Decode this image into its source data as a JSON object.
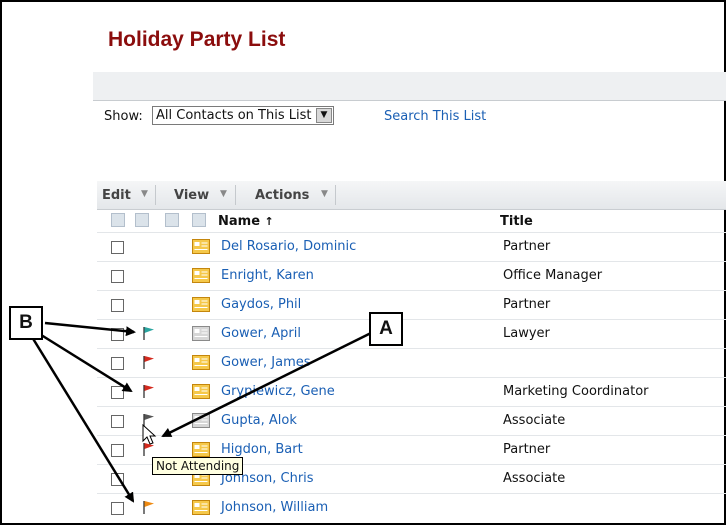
{
  "page": {
    "title": "Holiday Party List"
  },
  "filter": {
    "show_label": "Show:",
    "selected": "All Contacts on This List",
    "search_link": "Search This List"
  },
  "toolbar": {
    "edit": "Edit",
    "view": "View",
    "actions": "Actions"
  },
  "columns": {
    "name": "Name",
    "sort_indicator": "↑",
    "title": "Title"
  },
  "rows": [
    {
      "name": "Del Rosario, Dominic",
      "title": "Partner",
      "flag": "none",
      "card": "card-icon"
    },
    {
      "name": "Enright, Karen",
      "title": "Office Manager",
      "flag": "none",
      "card": "card-icon"
    },
    {
      "name": "Gaydos, Phil",
      "title": "Partner",
      "flag": "none",
      "card": "card-icon"
    },
    {
      "name": "Gower, April",
      "title": "Lawyer",
      "flag": "teal",
      "card": "card-gray-icon"
    },
    {
      "name": "Gower, James",
      "title": "",
      "flag": "red",
      "card": "card-icon"
    },
    {
      "name": "Grypiewicz, Gene",
      "title": "Marketing Coordinator",
      "flag": "red",
      "card": "card-icon"
    },
    {
      "name": "Gupta, Alok",
      "title": "Associate",
      "flag": "gray",
      "card": "card-gray-icon"
    },
    {
      "name": "Higdon, Bart",
      "title": "Partner",
      "flag": "red",
      "card": "card-icon"
    },
    {
      "name": "Johnson, Chris",
      "title": "Associate",
      "flag": "none",
      "card": "card-icon"
    },
    {
      "name": "Johnson, William",
      "title": "",
      "flag": "orange",
      "card": "card-icon"
    }
  ],
  "tooltip": "Not Attending",
  "callouts": {
    "a": "A",
    "b": "B"
  },
  "colors": {
    "title": "#8b0d0d",
    "link": "#1a5fb4",
    "teal_flag": "#2aa5a0",
    "red_flag": "#d42a1e",
    "gray_flag": "#555555",
    "orange_flag": "#ee8a12"
  }
}
